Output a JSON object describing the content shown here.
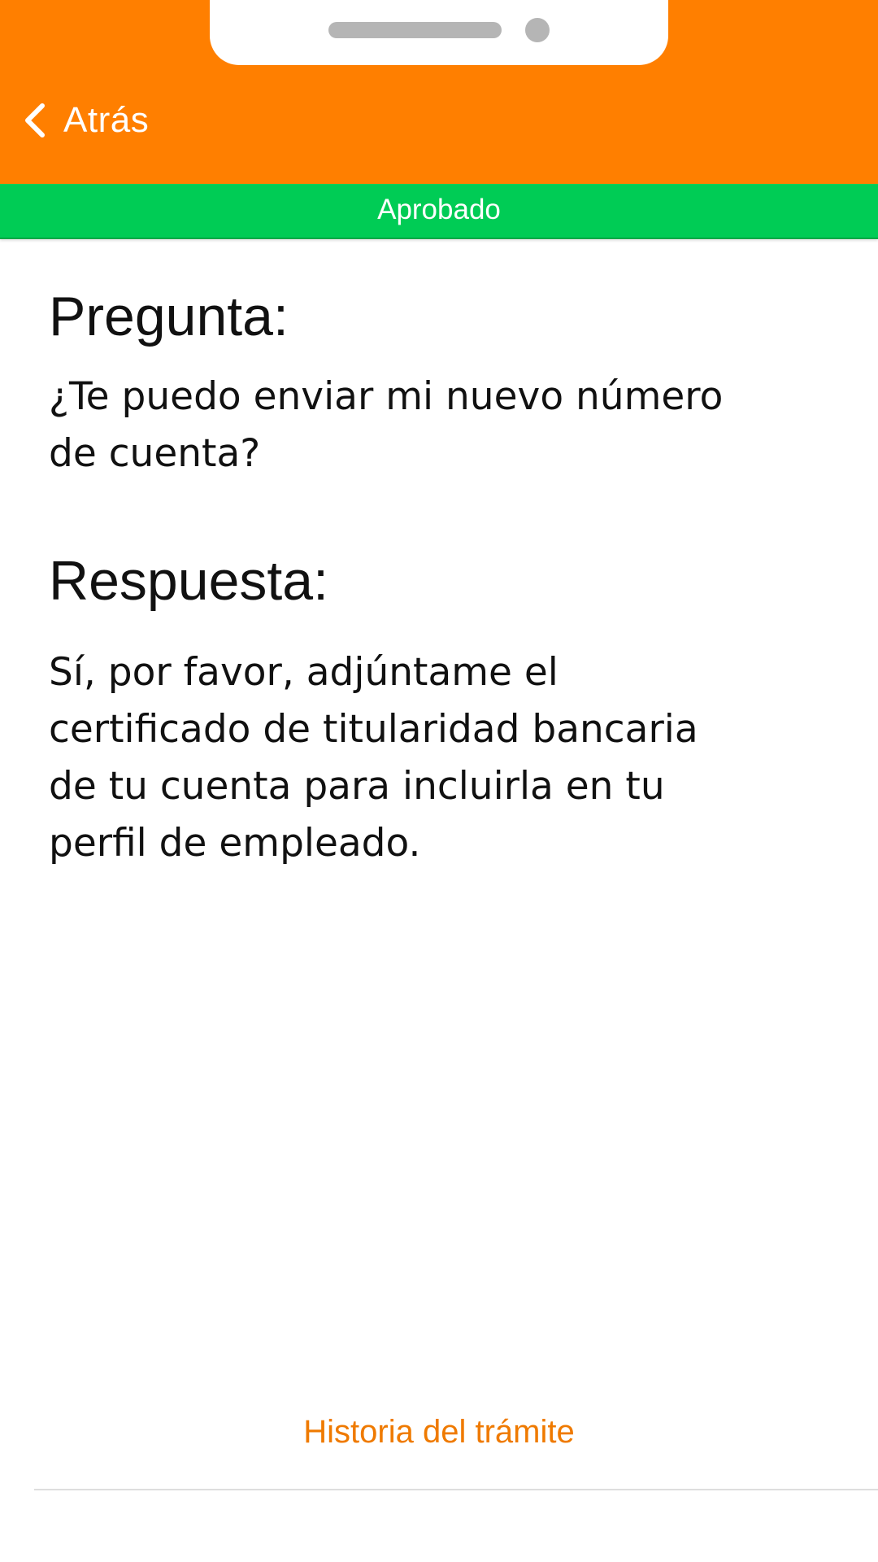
{
  "header": {
    "back_label": "Atrás",
    "background_color": "#ff7f00"
  },
  "status": {
    "label": "Aprobado",
    "color": "#00cc55"
  },
  "question": {
    "heading": "Pregunta:",
    "text": "¿Te puedo enviar mi nuevo número de cuenta?"
  },
  "answer": {
    "heading": "Respuesta:",
    "text": "Sí, por favor, adjúntame el certificado de titularidad bancaria de tu cuenta para incluirla en tu perfil de empleado."
  },
  "footer": {
    "history_link": "Historia del trámite",
    "link_color": "#ef7a00"
  },
  "icons": {
    "back": "chevron-left-icon"
  }
}
